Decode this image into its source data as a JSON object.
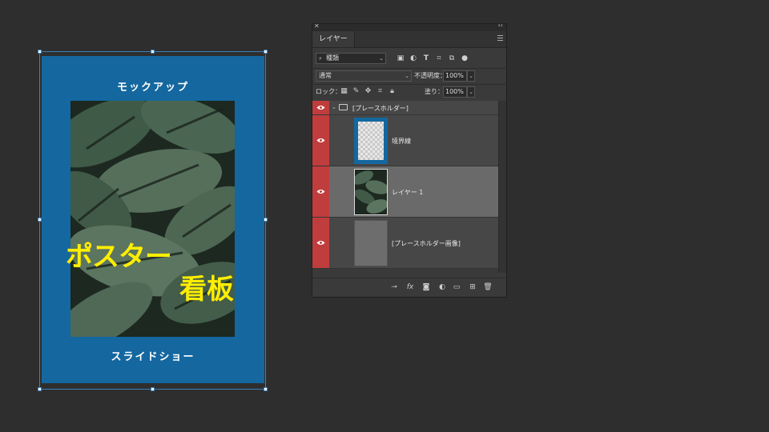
{
  "poster": {
    "top_text": "モックアップ",
    "headline_1": "ポスター",
    "headline_2": "看板",
    "bottom_text": "スライドショー",
    "background_color": "#14679f",
    "headline_color": "#ffee00"
  },
  "panel": {
    "tab_label": "レイヤー",
    "filter_label": "種類",
    "blend_mode": "通常",
    "opacity_label": "不透明度：",
    "opacity_value": "100%",
    "lock_label": "ロック：",
    "fill_label": "塗り：",
    "fill_value": "100%",
    "layers": [
      {
        "name": "[プレースホルダー]",
        "kind": "group",
        "visible": true
      },
      {
        "name": "境界線",
        "kind": "layer",
        "visible": true
      },
      {
        "name": "レイヤー 1",
        "kind": "layer",
        "visible": true,
        "selected": true
      },
      {
        "name": "[プレースホルダー画像]",
        "kind": "layer",
        "visible": true
      }
    ],
    "filter_icons": [
      "image-filter-icon",
      "adjustment-filter-icon",
      "type-filter-icon",
      "shape-filter-icon",
      "smart-object-filter-icon",
      "filter-toggle-icon"
    ],
    "lock_icons": [
      "lock-transparent-icon",
      "lock-image-icon",
      "lock-position-icon",
      "lock-artboard-icon",
      "lock-all-icon"
    ],
    "footer_icons": [
      "link-layers-icon",
      "fx-icon",
      "add-mask-icon",
      "adjustment-layer-icon",
      "new-group-icon",
      "new-layer-icon",
      "trash-icon"
    ]
  },
  "colors": {
    "visibility_red": "#c03d3d",
    "selection_blue": "#3c7fb8"
  }
}
